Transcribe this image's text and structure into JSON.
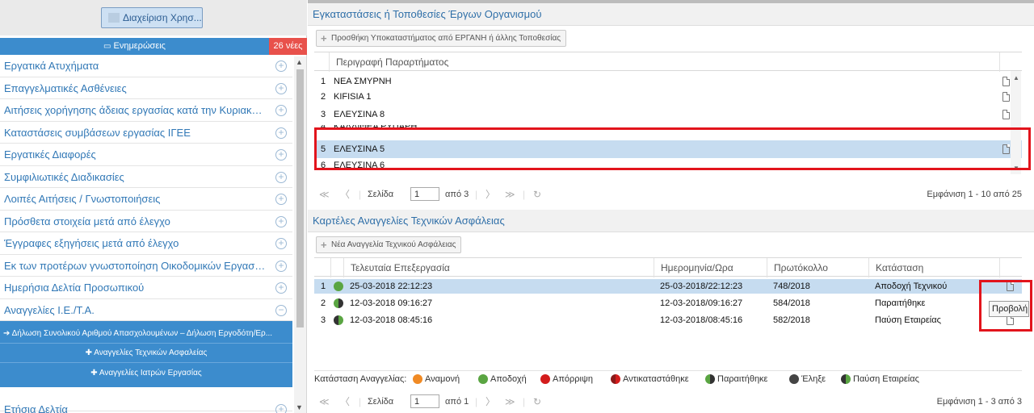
{
  "left": {
    "manage_button": "Διαχείριση Χρησ...",
    "updates_label": "Ενημερώσεις",
    "updates_badge": "26 νέες",
    "menu": [
      "Εργατικά Ατυχήματα",
      "Επαγγελματικές Ασθένειες",
      "Αιτήσεις χορήγησης άδειας εργασίας κατά την Κυριακή & ...",
      "Καταστάσεις συμβάσεων εργασίας ΙΓΕΕ",
      "Εργατικές Διαφορές",
      "Συμφιλιωτικές Διαδικασίες",
      "Λοιπές Αιτήσεις / Γνωστοποιήσεις",
      "Πρόσθετα στοιχεία μετά από έλεγχο",
      "Έγγραφες εξηγήσεις μετά από έλεγχο",
      "Εκ των προτέρων γνωστοποίηση Οικοδομικών Εργασιών",
      "Ημερήσια Δελτία Προσωπικού",
      "Αναγγελίες Ι.Ε./Τ.Α."
    ],
    "submenu": [
      "Δήλωση Συνολικού Αριθμού Απασχολουμένων – Δήλωση Εργοδότη/Ερ...",
      "Αναγγελίες Τεχνικών Ασφαλείας",
      "Αναγγελίες Ιατρών Εργασίας"
    ],
    "last_item": "Ετήσια Δελτία"
  },
  "sites": {
    "title": "Εγκαταστάσεις ή Τοποθεσίες Έργων Οργανισμού",
    "add_button": "Προσθήκη Υποκαταστήματος από ΕΡΓΑΝΗ ή άλλης Τοποθεσίας",
    "column": "Περιγραφή Παραρτήματος",
    "rows": [
      {
        "n": "1",
        "name": "ΝΕΑ ΣΜΥΡΝΗ"
      },
      {
        "n": "2",
        "name": "KIFISIA 1"
      },
      {
        "n": "3",
        "name": "ΕΛΕΥΣΙΝΑ 8"
      },
      {
        "n": "4",
        "name": "ΚΑΛΛΙΘΕΑ ΡΥΠΑΡΗ"
      },
      {
        "n": "5",
        "name": "ΕΛΕΥΣΙΝΑ 5"
      },
      {
        "n": "6",
        "name": "ΕΛΕΥΣΙΝΑ 6"
      }
    ],
    "pager": {
      "page_label": "Σελίδα",
      "page": "1",
      "of": "από 3",
      "info": "Εμφάνιση 1 - 10 από 25"
    }
  },
  "cards": {
    "title": "Καρτέλες Αναγγελίες Τεχνικών Ασφάλειας",
    "add_button": "Νέα Αναγγελία Τεχνικού Ασφάλειας",
    "columns": [
      "Τελευταία Επεξεργασία",
      "Ημερομηνία/Ωρα",
      "Πρωτόκολλο",
      "Κατάσταση"
    ],
    "rows": [
      {
        "n": "1",
        "status_icon": "accepted",
        "last": "25-03-2018 22:12:23",
        "date": "25-03-2018/22:12:23",
        "protocol": "748/2018",
        "state": "Αποδοχή Τεχνικού"
      },
      {
        "n": "2",
        "status_icon": "resigned",
        "last": "12-03-2018 09:16:27",
        "date": "12-03-2018/09:16:27",
        "protocol": "584/2018",
        "state": "Παραιτήθηκε"
      },
      {
        "n": "3",
        "status_icon": "company-stop",
        "last": "12-03-2018 08:45:16",
        "date": "12-03-2018/08:45:16",
        "protocol": "582/2018",
        "state": "Παύση Εταιρείας"
      }
    ],
    "tooltip": "Προβολή",
    "legend_title": "Κατάσταση Αναγγελίας:",
    "legend": [
      {
        "label": "Αναμονή",
        "color": "#f08a24"
      },
      {
        "label": "Αποδοχή",
        "color": "#5aa542"
      },
      {
        "label": "Απόρριψη",
        "color": "#d31c1c"
      },
      {
        "label": "Αντικαταστάθηκε",
        "color": "#8a1a1a"
      },
      {
        "label": "Παραιτήθηκε",
        "color": "#5aa542"
      },
      {
        "label": "Έληξε",
        "color": "#444444"
      },
      {
        "label": "Παύση Εταιρείας",
        "color": "#333333"
      }
    ],
    "pager": {
      "page_label": "Σελίδα",
      "page": "1",
      "of": "από 1",
      "info": "Εμφάνιση 1 - 3 από 3"
    }
  }
}
